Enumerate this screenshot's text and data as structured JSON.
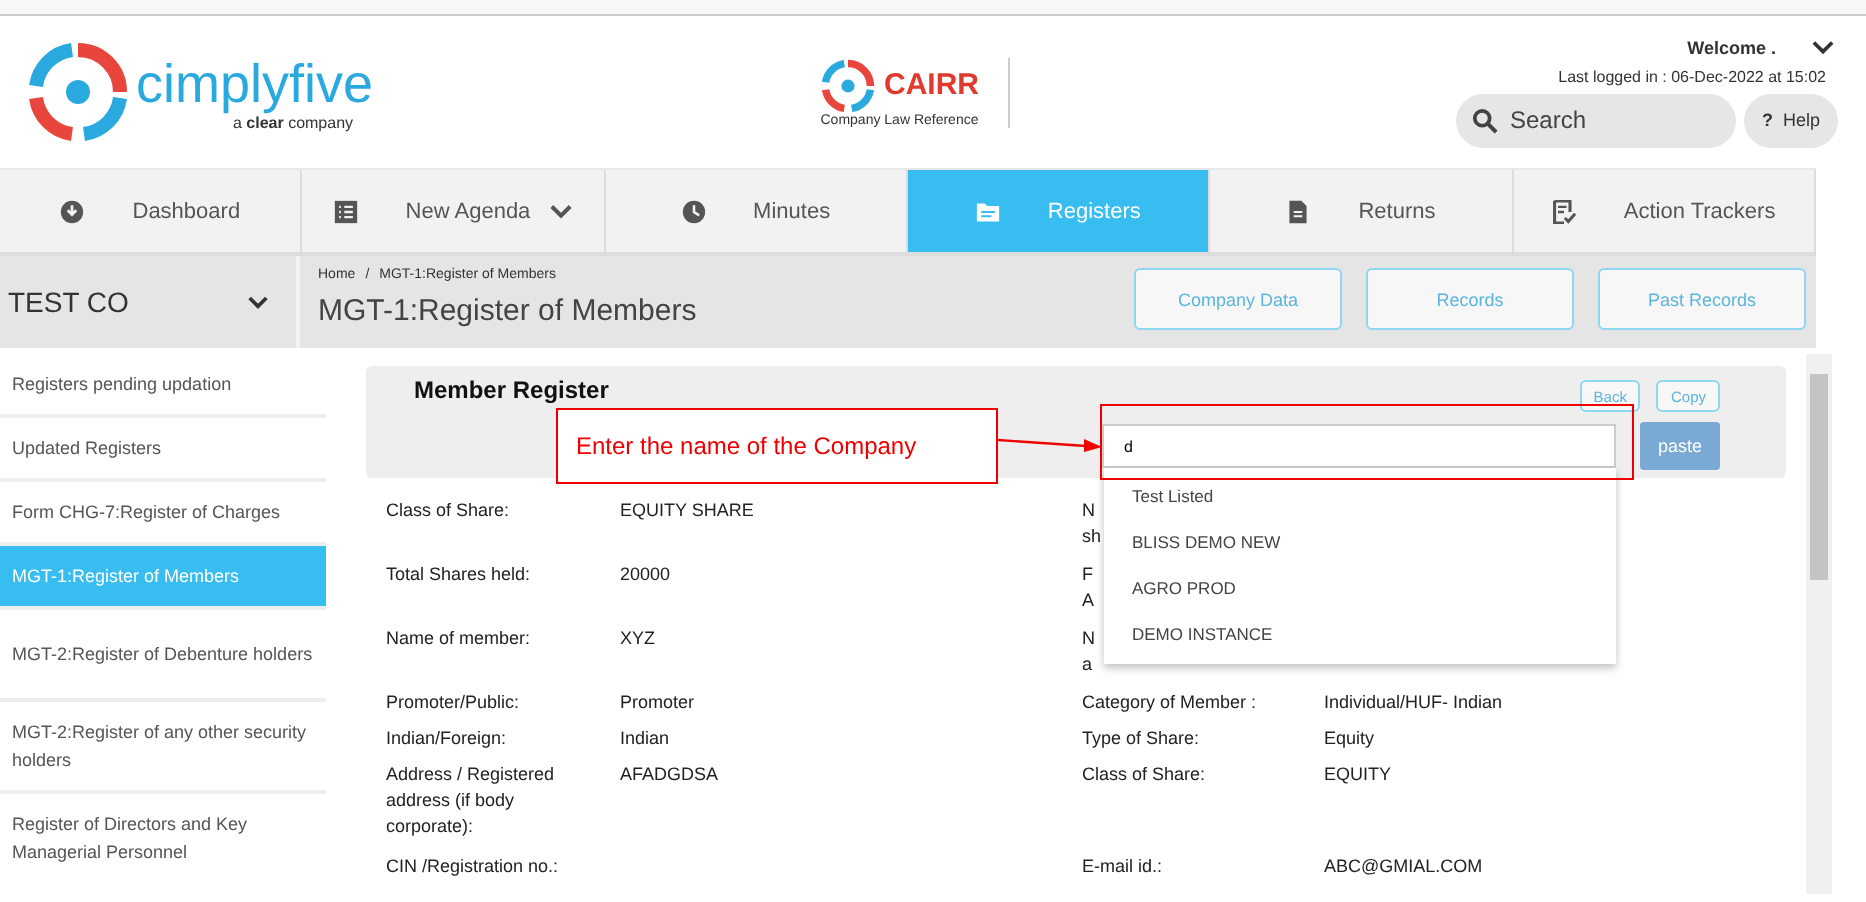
{
  "header": {
    "logo": {
      "name": "cimplyfive",
      "tagline_prefix": "a",
      "tagline_brand": "clear",
      "tagline_suffix": "company"
    },
    "partner": {
      "name": "CAIRR",
      "subtitle": "Company Law Reference"
    },
    "user": {
      "welcome": "Welcome .",
      "last_login": "Last logged in : 06-Dec-2022 at 15:02"
    },
    "search": {
      "placeholder": "Search"
    },
    "help": {
      "icon": "?",
      "label": "Help"
    }
  },
  "tabs": [
    {
      "label": "Dashboard",
      "selected": false,
      "dropdown": false
    },
    {
      "label": "New Agenda",
      "selected": false,
      "dropdown": true
    },
    {
      "label": "Minutes",
      "selected": false,
      "dropdown": false
    },
    {
      "label": "Registers",
      "selected": true,
      "dropdown": false
    },
    {
      "label": "Returns",
      "selected": false,
      "dropdown": false
    },
    {
      "label": "Action Trackers",
      "selected": false,
      "dropdown": false
    }
  ],
  "company_selector": {
    "value": "TEST CO"
  },
  "breadcrumb": [
    "Home",
    "MGT-1:Register of Members"
  ],
  "breadcrumb_separator": "/",
  "page_title": "MGT-1:Register of Members",
  "page_buttons": [
    "Company Data",
    "Records",
    "Past Records"
  ],
  "sidebar": {
    "items": [
      {
        "label": "Registers pending updation",
        "selected": false
      },
      {
        "label": "Updated Registers",
        "selected": false
      },
      {
        "label": "Form CHG-7:Register of Charges",
        "selected": false
      },
      {
        "label": "MGT-1:Register of Members",
        "selected": true
      },
      {
        "label": "MGT-2:Register of Debenture holders",
        "selected": false
      },
      {
        "label": "MGT-2:Register of any other security holders",
        "selected": false
      },
      {
        "label": "Register of Directors and Key Managerial Personnel",
        "selected": false
      }
    ]
  },
  "panel": {
    "title": "Member Register",
    "buttons": [
      "Back",
      "Copy"
    ],
    "company_field": {
      "value": "d"
    },
    "paste_button": "paste",
    "suggestions": [
      "Test Listed",
      "BLISS DEMO NEW",
      "AGRO PROD",
      "DEMO INSTANCE"
    ],
    "rows": [
      {
        "left_label": "Class of Share:",
        "left_value": "EQUITY SHARE",
        "right_label": [
          "N",
          "sh"
        ]
      },
      {
        "left_label": "Total Shares held:",
        "left_value": "20000",
        "right_label": [
          "F",
          "A"
        ]
      },
      {
        "left_label": "Name of member:",
        "left_value": "XYZ",
        "right_label": [
          "N",
          "a"
        ]
      },
      {
        "left_label": "Promoter/Public:",
        "left_value": "Promoter",
        "right_label": [
          "Category of Member :"
        ],
        "right_value": "Individual/HUF- Indian"
      },
      {
        "left_label": "Indian/Foreign:",
        "left_value": "Indian",
        "right_label": [
          "Type of Share:"
        ],
        "right_value": "Equity"
      },
      {
        "left_label": "Address / Registered address (if body corporate):",
        "left_value": "AFADGDSA",
        "right_label": [
          "Class of Share:"
        ],
        "right_value": "EQUITY"
      },
      {
        "left_label": "CIN /Registration no.:",
        "right_label": [
          "E-mail id.:"
        ],
        "right_value": "ABC@GMIAL.COM"
      }
    ]
  },
  "annotation": {
    "text": "Enter the name of the Company"
  }
}
